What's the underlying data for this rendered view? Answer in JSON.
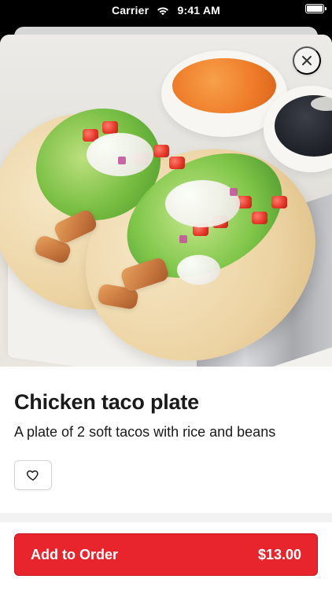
{
  "status_bar": {
    "carrier": "Carrier",
    "time": "9:41 AM",
    "icons": [
      "wifi-icon",
      "battery-icon"
    ]
  },
  "sheet": {
    "close_icon": "close-icon"
  },
  "item": {
    "title": "Chicken taco plate",
    "description": "A plate of 2 soft tacos with rice and beans"
  },
  "actions": {
    "favorite_icon": "heart-icon",
    "add_to_order_label": "Add to Order",
    "price": "$13.00"
  },
  "colors": {
    "accent": "#e8242d",
    "text": "#1a1a1a",
    "status_bar": "#000000"
  }
}
